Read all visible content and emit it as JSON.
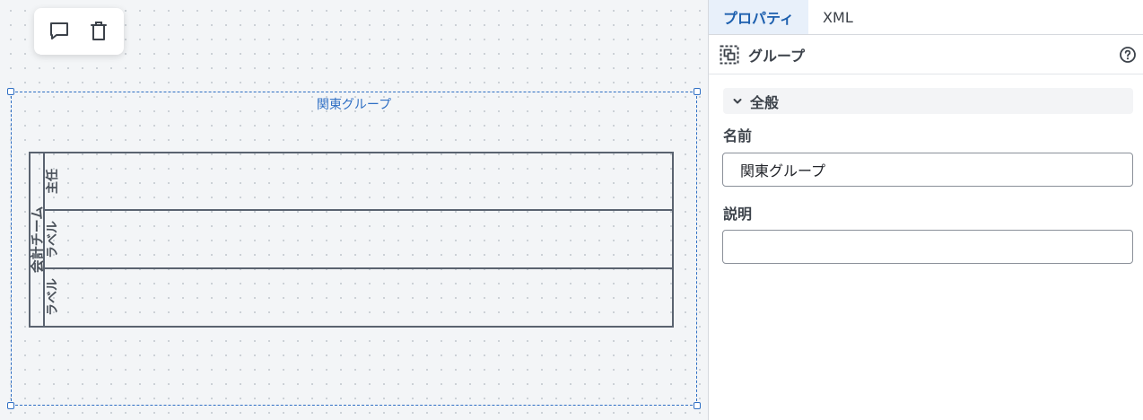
{
  "canvas": {
    "toolbar": {
      "comment_icon": "speech-bubble-icon",
      "delete_icon": "trash-icon"
    },
    "group": {
      "label": "関東グループ",
      "selection_color": "#2f6fc4"
    },
    "pool": {
      "name": "会計チーム",
      "lanes": [
        {
          "label": "主任"
        },
        {
          "label": "ラベル"
        },
        {
          "label": "ラベル"
        }
      ]
    }
  },
  "panel": {
    "tabs": [
      {
        "label": "プロパティ",
        "active": true
      },
      {
        "label": "XML",
        "active": false
      }
    ],
    "element": {
      "type_icon": "group-icon",
      "title": "グループ",
      "help_icon": "help-circle-icon"
    },
    "section": {
      "title": "全般",
      "expanded": true
    },
    "fields": {
      "name_label": "名前",
      "name_value": "関東グループ",
      "description_label": "説明",
      "description_value": ""
    }
  }
}
